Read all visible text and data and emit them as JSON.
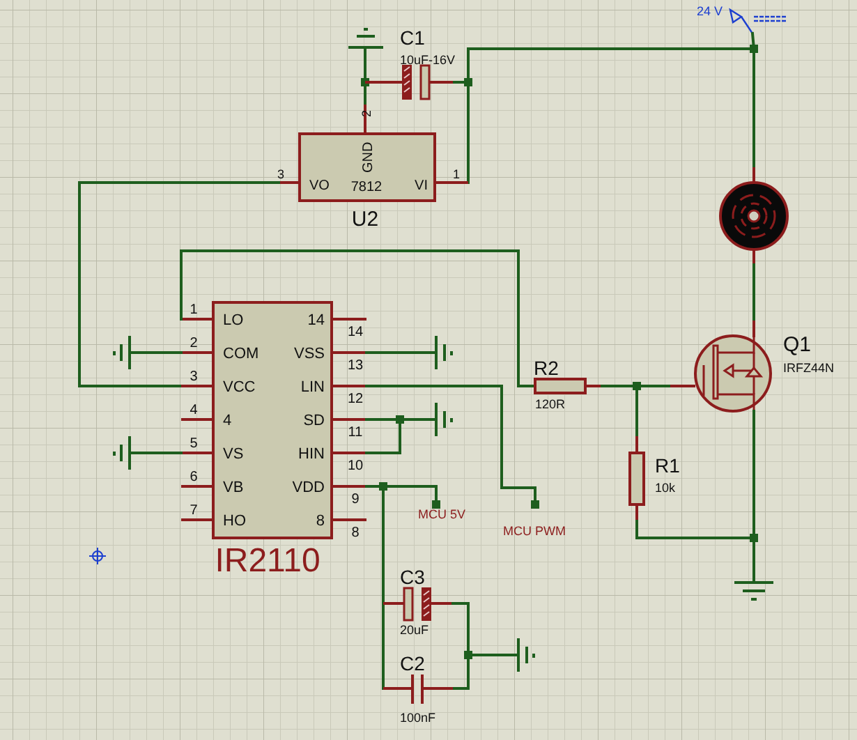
{
  "supply": {
    "label": "24 V"
  },
  "c1": {
    "ref": "C1",
    "value": "10uF-16V"
  },
  "u2": {
    "ref": "U2",
    "part": "7812",
    "pins": [
      {
        "number": "3",
        "name": "VO"
      },
      {
        "number": "2",
        "name": "GND"
      },
      {
        "number": "1",
        "name": "VI"
      }
    ]
  },
  "ic": {
    "ref": "IR2110",
    "left_pins": [
      {
        "number": "1",
        "name": "LO"
      },
      {
        "number": "2",
        "name": "COM"
      },
      {
        "number": "3",
        "name": "VCC"
      },
      {
        "number": "4",
        "name": "4"
      },
      {
        "number": "5",
        "name": "VS"
      },
      {
        "number": "6",
        "name": "VB"
      },
      {
        "number": "7",
        "name": "HO"
      }
    ],
    "right_pins": [
      {
        "number": "14",
        "name": "14"
      },
      {
        "number": "13",
        "name": "VSS"
      },
      {
        "number": "12",
        "name": "LIN"
      },
      {
        "number": "11",
        "name": "SD"
      },
      {
        "number": "10",
        "name": "HIN"
      },
      {
        "number": "9",
        "name": "VDD"
      },
      {
        "number": "8",
        "name": "8"
      }
    ]
  },
  "q1": {
    "ref": "Q1",
    "value": "IRFZ44N"
  },
  "r2": {
    "ref": "R2",
    "value": "120R"
  },
  "r1": {
    "ref": "R1",
    "value": "10k"
  },
  "net_labels": [
    {
      "text": "MCU 5V"
    },
    {
      "text": "MCU PWM"
    }
  ],
  "c3": {
    "ref": "C3",
    "value": "20uF"
  },
  "c2": {
    "ref": "C2",
    "value": "100nF"
  }
}
